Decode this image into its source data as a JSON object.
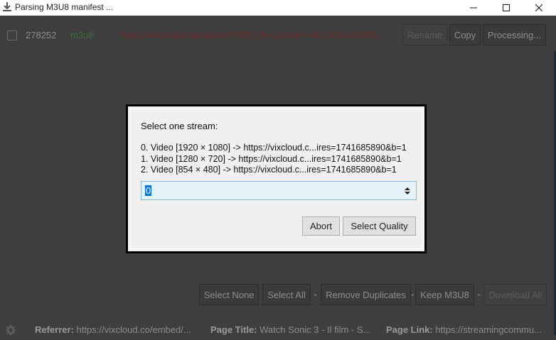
{
  "window": {
    "title": "Parsing M3U8 manifest ..."
  },
  "row": {
    "id": "278252",
    "type": "m3u8",
    "dash": "-",
    "url": "https://vixcloud.co/playlist/278252?b=1&token=afa167b0809f65...",
    "rename_label": "Rename",
    "copy_label": "Copy",
    "processing_label": "Processing..."
  },
  "actions": {
    "select_none": "Select None",
    "select_all": "Select All",
    "remove_duplicates": "Remove Duplicates",
    "keep_m3u8": "Keep M3U8",
    "download_all": "Download All"
  },
  "footer": {
    "referrer_label": "Referrer:",
    "referrer_value": "https://vixcloud.co/embed/...",
    "page_title_label": "Page Title:",
    "page_title_value": "Watch Sonic 3 - Il film - S...",
    "page_link_label": "Page Link:",
    "page_link_value": "https://streamingcommu..."
  },
  "dialog": {
    "prompt": "Select one stream:",
    "streams": [
      "0. Video [1920 × 1080] -> https://vixcloud.c...ires=1741685890&b=1",
      "1. Video [1280 × 720] -> https://vixcloud.c...ires=1741685890&b=1",
      "2. Video [854 × 480] -> https://vixcloud.c...ires=1741685890&b=1"
    ],
    "selected_value": "0",
    "abort_label": "Abort",
    "select_quality_label": "Select Quality"
  }
}
